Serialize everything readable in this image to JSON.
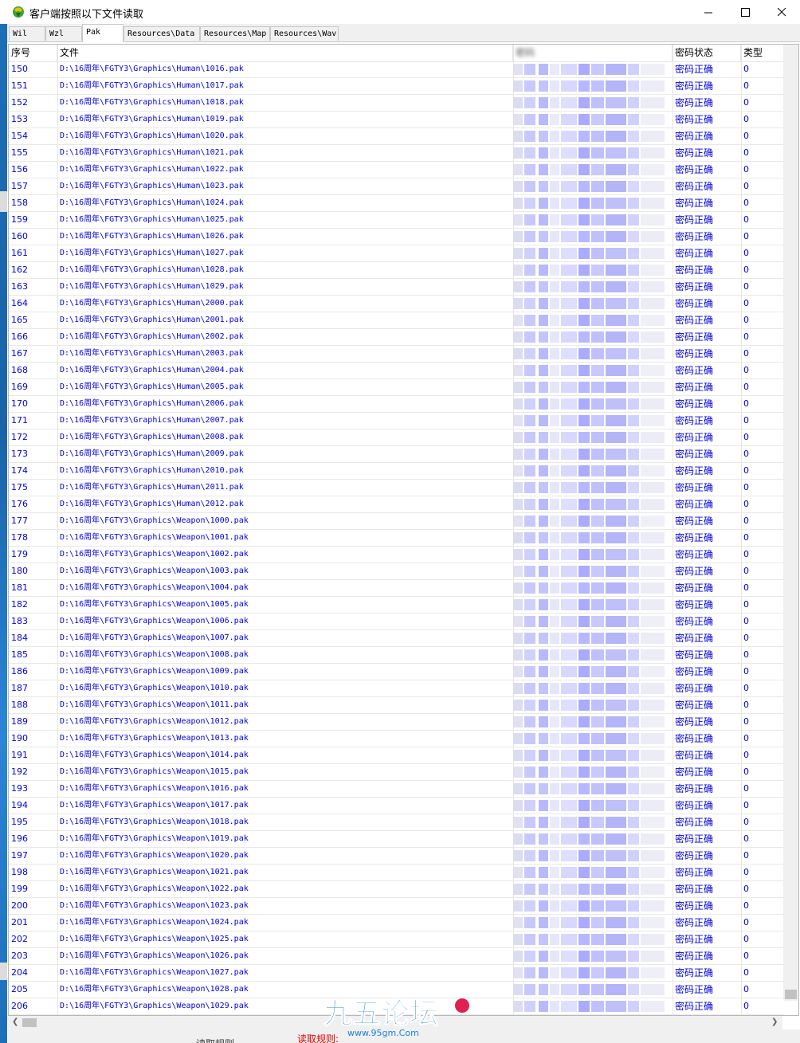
{
  "window": {
    "title": "客户端按照以下文件读取",
    "minimize_glyph": "—",
    "close_glyph": "✕"
  },
  "tabs": [
    {
      "label": "Wil",
      "active": false
    },
    {
      "label": "Wzl",
      "active": false
    },
    {
      "label": "Pak",
      "active": true
    },
    {
      "label": "Resources\\Data",
      "active": false
    },
    {
      "label": "Resources\\Map",
      "active": false
    },
    {
      "label": "Resources\\Wav",
      "active": false
    }
  ],
  "columns": {
    "index": "序号",
    "file": "文件",
    "password": "密码",
    "status": "密码状态",
    "type": "类型"
  },
  "rows": [
    {
      "index": "150",
      "file": "D:\\16周年\\FGTY3\\Graphics\\Human\\1016.pak",
      "status": "密码正确",
      "type": "0"
    },
    {
      "index": "151",
      "file": "D:\\16周年\\FGTY3\\Graphics\\Human\\1017.pak",
      "status": "密码正确",
      "type": "0"
    },
    {
      "index": "152",
      "file": "D:\\16周年\\FGTY3\\Graphics\\Human\\1018.pak",
      "status": "密码正确",
      "type": "0"
    },
    {
      "index": "153",
      "file": "D:\\16周年\\FGTY3\\Graphics\\Human\\1019.pak",
      "status": "密码正确",
      "type": "0"
    },
    {
      "index": "154",
      "file": "D:\\16周年\\FGTY3\\Graphics\\Human\\1020.pak",
      "status": "密码正确",
      "type": "0"
    },
    {
      "index": "155",
      "file": "D:\\16周年\\FGTY3\\Graphics\\Human\\1021.pak",
      "status": "密码正确",
      "type": "0"
    },
    {
      "index": "156",
      "file": "D:\\16周年\\FGTY3\\Graphics\\Human\\1022.pak",
      "status": "密码正确",
      "type": "0"
    },
    {
      "index": "157",
      "file": "D:\\16周年\\FGTY3\\Graphics\\Human\\1023.pak",
      "status": "密码正确",
      "type": "0"
    },
    {
      "index": "158",
      "file": "D:\\16周年\\FGTY3\\Graphics\\Human\\1024.pak",
      "status": "密码正确",
      "type": "0"
    },
    {
      "index": "159",
      "file": "D:\\16周年\\FGTY3\\Graphics\\Human\\1025.pak",
      "status": "密码正确",
      "type": "0"
    },
    {
      "index": "160",
      "file": "D:\\16周年\\FGTY3\\Graphics\\Human\\1026.pak",
      "status": "密码正确",
      "type": "0"
    },
    {
      "index": "161",
      "file": "D:\\16周年\\FGTY3\\Graphics\\Human\\1027.pak",
      "status": "密码正确",
      "type": "0"
    },
    {
      "index": "162",
      "file": "D:\\16周年\\FGTY3\\Graphics\\Human\\1028.pak",
      "status": "密码正确",
      "type": "0"
    },
    {
      "index": "163",
      "file": "D:\\16周年\\FGTY3\\Graphics\\Human\\1029.pak",
      "status": "密码正确",
      "type": "0"
    },
    {
      "index": "164",
      "file": "D:\\16周年\\FGTY3\\Graphics\\Human\\2000.pak",
      "status": "密码正确",
      "type": "0"
    },
    {
      "index": "165",
      "file": "D:\\16周年\\FGTY3\\Graphics\\Human\\2001.pak",
      "status": "密码正确",
      "type": "0"
    },
    {
      "index": "166",
      "file": "D:\\16周年\\FGTY3\\Graphics\\Human\\2002.pak",
      "status": "密码正确",
      "type": "0"
    },
    {
      "index": "167",
      "file": "D:\\16周年\\FGTY3\\Graphics\\Human\\2003.pak",
      "status": "密码正确",
      "type": "0"
    },
    {
      "index": "168",
      "file": "D:\\16周年\\FGTY3\\Graphics\\Human\\2004.pak",
      "status": "密码正确",
      "type": "0"
    },
    {
      "index": "169",
      "file": "D:\\16周年\\FGTY3\\Graphics\\Human\\2005.pak",
      "status": "密码正确",
      "type": "0"
    },
    {
      "index": "170",
      "file": "D:\\16周年\\FGTY3\\Graphics\\Human\\2006.pak",
      "status": "密码正确",
      "type": "0"
    },
    {
      "index": "171",
      "file": "D:\\16周年\\FGTY3\\Graphics\\Human\\2007.pak",
      "status": "密码正确",
      "type": "0"
    },
    {
      "index": "172",
      "file": "D:\\16周年\\FGTY3\\Graphics\\Human\\2008.pak",
      "status": "密码正确",
      "type": "0"
    },
    {
      "index": "173",
      "file": "D:\\16周年\\FGTY3\\Graphics\\Human\\2009.pak",
      "status": "密码正确",
      "type": "0"
    },
    {
      "index": "174",
      "file": "D:\\16周年\\FGTY3\\Graphics\\Human\\2010.pak",
      "status": "密码正确",
      "type": "0"
    },
    {
      "index": "175",
      "file": "D:\\16周年\\FGTY3\\Graphics\\Human\\2011.pak",
      "status": "密码正确",
      "type": "0"
    },
    {
      "index": "176",
      "file": "D:\\16周年\\FGTY3\\Graphics\\Human\\2012.pak",
      "status": "密码正确",
      "type": "0"
    },
    {
      "index": "177",
      "file": "D:\\16周年\\FGTY3\\Graphics\\Weapon\\1000.pak",
      "status": "密码正确",
      "type": "0"
    },
    {
      "index": "178",
      "file": "D:\\16周年\\FGTY3\\Graphics\\Weapon\\1001.pak",
      "status": "密码正确",
      "type": "0"
    },
    {
      "index": "179",
      "file": "D:\\16周年\\FGTY3\\Graphics\\Weapon\\1002.pak",
      "status": "密码正确",
      "type": "0"
    },
    {
      "index": "180",
      "file": "D:\\16周年\\FGTY3\\Graphics\\Weapon\\1003.pak",
      "status": "密码正确",
      "type": "0"
    },
    {
      "index": "181",
      "file": "D:\\16周年\\FGTY3\\Graphics\\Weapon\\1004.pak",
      "status": "密码正确",
      "type": "0"
    },
    {
      "index": "182",
      "file": "D:\\16周年\\FGTY3\\Graphics\\Weapon\\1005.pak",
      "status": "密码正确",
      "type": "0"
    },
    {
      "index": "183",
      "file": "D:\\16周年\\FGTY3\\Graphics\\Weapon\\1006.pak",
      "status": "密码正确",
      "type": "0"
    },
    {
      "index": "184",
      "file": "D:\\16周年\\FGTY3\\Graphics\\Weapon\\1007.pak",
      "status": "密码正确",
      "type": "0"
    },
    {
      "index": "185",
      "file": "D:\\16周年\\FGTY3\\Graphics\\Weapon\\1008.pak",
      "status": "密码正确",
      "type": "0"
    },
    {
      "index": "186",
      "file": "D:\\16周年\\FGTY3\\Graphics\\Weapon\\1009.pak",
      "status": "密码正确",
      "type": "0"
    },
    {
      "index": "187",
      "file": "D:\\16周年\\FGTY3\\Graphics\\Weapon\\1010.pak",
      "status": "密码正确",
      "type": "0"
    },
    {
      "index": "188",
      "file": "D:\\16周年\\FGTY3\\Graphics\\Weapon\\1011.pak",
      "status": "密码正确",
      "type": "0"
    },
    {
      "index": "189",
      "file": "D:\\16周年\\FGTY3\\Graphics\\Weapon\\1012.pak",
      "status": "密码正确",
      "type": "0"
    },
    {
      "index": "190",
      "file": "D:\\16周年\\FGTY3\\Graphics\\Weapon\\1013.pak",
      "status": "密码正确",
      "type": "0"
    },
    {
      "index": "191",
      "file": "D:\\16周年\\FGTY3\\Graphics\\Weapon\\1014.pak",
      "status": "密码正确",
      "type": "0"
    },
    {
      "index": "192",
      "file": "D:\\16周年\\FGTY3\\Graphics\\Weapon\\1015.pak",
      "status": "密码正确",
      "type": "0"
    },
    {
      "index": "193",
      "file": "D:\\16周年\\FGTY3\\Graphics\\Weapon\\1016.pak",
      "status": "密码正确",
      "type": "0"
    },
    {
      "index": "194",
      "file": "D:\\16周年\\FGTY3\\Graphics\\Weapon\\1017.pak",
      "status": "密码正确",
      "type": "0"
    },
    {
      "index": "195",
      "file": "D:\\16周年\\FGTY3\\Graphics\\Weapon\\1018.pak",
      "status": "密码正确",
      "type": "0"
    },
    {
      "index": "196",
      "file": "D:\\16周年\\FGTY3\\Graphics\\Weapon\\1019.pak",
      "status": "密码正确",
      "type": "0"
    },
    {
      "index": "197",
      "file": "D:\\16周年\\FGTY3\\Graphics\\Weapon\\1020.pak",
      "status": "密码正确",
      "type": "0"
    },
    {
      "index": "198",
      "file": "D:\\16周年\\FGTY3\\Graphics\\Weapon\\1021.pak",
      "status": "密码正确",
      "type": "0"
    },
    {
      "index": "199",
      "file": "D:\\16周年\\FGTY3\\Graphics\\Weapon\\1022.pak",
      "status": "密码正确",
      "type": "0"
    },
    {
      "index": "200",
      "file": "D:\\16周年\\FGTY3\\Graphics\\Weapon\\1023.pak",
      "status": "密码正确",
      "type": "0"
    },
    {
      "index": "201",
      "file": "D:\\16周年\\FGTY3\\Graphics\\Weapon\\1024.pak",
      "status": "密码正确",
      "type": "0"
    },
    {
      "index": "202",
      "file": "D:\\16周年\\FGTY3\\Graphics\\Weapon\\1025.pak",
      "status": "密码正确",
      "type": "0"
    },
    {
      "index": "203",
      "file": "D:\\16周年\\FGTY3\\Graphics\\Weapon\\1026.pak",
      "status": "密码正确",
      "type": "0"
    },
    {
      "index": "204",
      "file": "D:\\16周年\\FGTY3\\Graphics\\Weapon\\1027.pak",
      "status": "密码正确",
      "type": "0"
    },
    {
      "index": "205",
      "file": "D:\\16周年\\FGTY3\\Graphics\\Weapon\\1028.pak",
      "status": "密码正确",
      "type": "0"
    },
    {
      "index": "206",
      "file": "D:\\16周年\\FGTY3\\Graphics\\Weapon\\1029.pak",
      "status": "密码正确",
      "type": "0"
    }
  ],
  "footer": {
    "rule_label": "读取规则:",
    "faded_label": "读取规则"
  },
  "watermark": {
    "text": "九五论坛",
    "site": "www.95gm.Com"
  },
  "colors": {
    "text_blue": "#0000e0",
    "accent_red": "#e00000",
    "redact_purple": "#b8b8ff"
  }
}
